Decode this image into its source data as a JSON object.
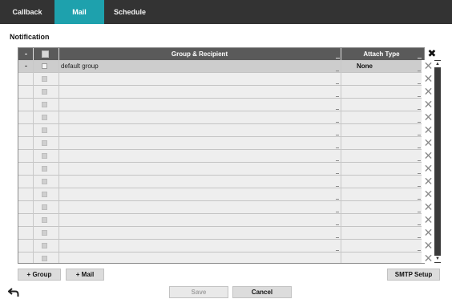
{
  "tabs": [
    {
      "label": "Callback",
      "active": false
    },
    {
      "label": "Mail",
      "active": true
    },
    {
      "label": "Schedule",
      "active": false
    }
  ],
  "section_title": "Notification",
  "table": {
    "headers": {
      "minus": "-",
      "group_recipient": "Group & Recipient",
      "attach_type": "Attach Type"
    },
    "rows": [
      {
        "expander": "-",
        "name": "default group",
        "attach": "None",
        "selected": true
      },
      {
        "expander": "",
        "name": "",
        "attach": "",
        "selected": false
      },
      {
        "expander": "",
        "name": "",
        "attach": "",
        "selected": false
      },
      {
        "expander": "",
        "name": "",
        "attach": "",
        "selected": false
      },
      {
        "expander": "",
        "name": "",
        "attach": "",
        "selected": false
      },
      {
        "expander": "",
        "name": "",
        "attach": "",
        "selected": false
      },
      {
        "expander": "",
        "name": "",
        "attach": "",
        "selected": false
      },
      {
        "expander": "",
        "name": "",
        "attach": "",
        "selected": false
      },
      {
        "expander": "",
        "name": "",
        "attach": "",
        "selected": false
      },
      {
        "expander": "",
        "name": "",
        "attach": "",
        "selected": false
      },
      {
        "expander": "",
        "name": "",
        "attach": "",
        "selected": false
      },
      {
        "expander": "",
        "name": "",
        "attach": "",
        "selected": false
      },
      {
        "expander": "",
        "name": "",
        "attach": "",
        "selected": false
      },
      {
        "expander": "",
        "name": "",
        "attach": "",
        "selected": false
      },
      {
        "expander": "",
        "name": "",
        "attach": "",
        "selected": false
      },
      {
        "expander": "",
        "name": "",
        "attach": "",
        "selected": false
      }
    ],
    "delete_glyph": "✕",
    "delete_all_glyph": "✖"
  },
  "buttons": {
    "add_group": "+ Group",
    "add_mail": "+ Mail",
    "smtp_setup": "SMTP Setup",
    "save": "Save",
    "cancel": "Cancel"
  },
  "icons": {
    "back": "back-arrow-icon",
    "scroll_up": "▲",
    "scroll_down": "▼"
  },
  "colors": {
    "tabbar": "#333333",
    "active_tab": "#1ea1ad",
    "header": "#5a5a5a",
    "selected_row": "#cdcdcd"
  }
}
